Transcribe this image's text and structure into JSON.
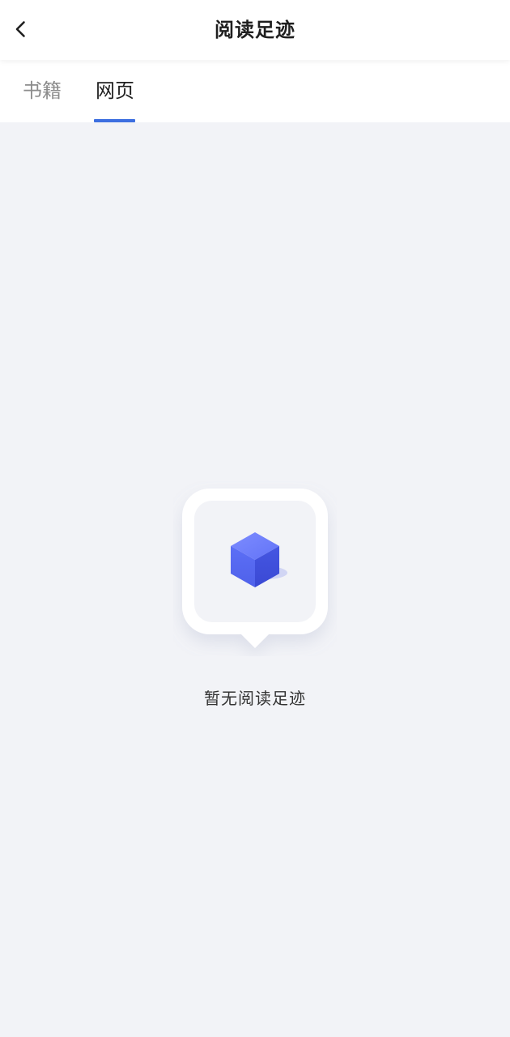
{
  "header": {
    "title": "阅读足迹",
    "back_icon": "chevron-left-icon"
  },
  "tabs": [
    {
      "label": "书籍",
      "selected": false
    },
    {
      "label": "网页",
      "selected": true
    }
  ],
  "empty_state": {
    "message": "暂无阅读足迹",
    "icon": "cube-icon"
  },
  "colors": {
    "background": "#f2f3f7",
    "accent": "#3d6fe0",
    "cube": "#5b6cf5"
  }
}
